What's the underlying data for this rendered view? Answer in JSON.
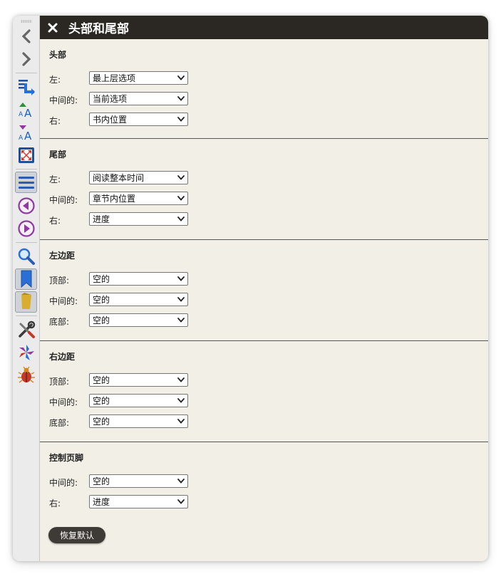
{
  "panel": {
    "title": "头部和尾部",
    "reset_label": "恢复默认"
  },
  "sections": [
    {
      "title": "头部",
      "rows": [
        {
          "label": "左:",
          "value": "最上层选项"
        },
        {
          "label": "中间的:",
          "value": "当前选项"
        },
        {
          "label": "右:",
          "value": "书内位置"
        }
      ]
    },
    {
      "title": "尾部",
      "rows": [
        {
          "label": "左:",
          "value": "阅读整本时间"
        },
        {
          "label": "中间的:",
          "value": "章节内位置"
        },
        {
          "label": "右:",
          "value": "进度"
        }
      ]
    },
    {
      "title": "左边距",
      "rows": [
        {
          "label": "顶部:",
          "value": "空的"
        },
        {
          "label": "中间的:",
          "value": "空的"
        },
        {
          "label": "底部:",
          "value": "空的"
        }
      ]
    },
    {
      "title": "右边距",
      "rows": [
        {
          "label": "顶部:",
          "value": "空的"
        },
        {
          "label": "中间的:",
          "value": "空的"
        },
        {
          "label": "底部:",
          "value": "空的"
        }
      ]
    },
    {
      "title": "控制页脚",
      "rows": [
        {
          "label": "中间的:",
          "value": "空的"
        },
        {
          "label": "右:",
          "value": "进度"
        }
      ]
    }
  ],
  "toolbar_icons": [
    "chevron-left-icon",
    "chevron-right-icon",
    "goto-location-icon",
    "font-size-increase-icon",
    "font-size-decrease-icon",
    "fullscreen-icon",
    "menu-icon",
    "previous-icon",
    "next-icon",
    "search-icon",
    "bookmark-icon",
    "highlight-icon",
    "tools-icon",
    "color-scheme-icon",
    "bug-icon"
  ],
  "colors": {
    "titlebar": "#2b2723",
    "panel_bg": "#f2f0e6",
    "toolbar_bg": "#ebebeb",
    "accent_purple": "#8e3aa0",
    "accent_blue": "#2a6fd6"
  }
}
